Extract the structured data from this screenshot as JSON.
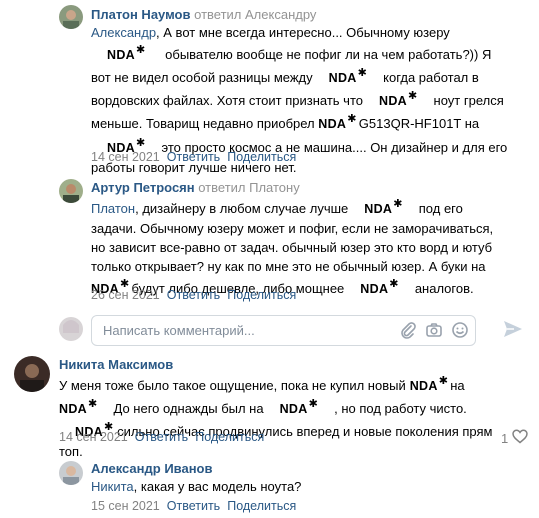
{
  "comments": [
    {
      "author": "Платон Наумов",
      "replied_word": "ответил",
      "reply_to": "Александру",
      "addr": "Александр",
      "text_parts": [
        ", А вот мне всегда интересно... Обычному юзеру",
        "обывателю вообще не пофиг ли на чем работать?)) Я вот не видел особой разницы между",
        "когда работал в вордовских файлах. Хотя стоит признать что",
        "ноут грелся меньше. Товарищ недавно приобрел",
        "G513QR-HF101T на",
        "это просто космос а не машина.... Он дизайнер и для его работы говорит лучше ничего нет."
      ],
      "date": "14 сен 2021",
      "reply": "Ответить",
      "share": "Поделиться"
    },
    {
      "author": "Артур Петросян",
      "replied_word": "ответил",
      "reply_to": "Платону",
      "addr": "Платон",
      "text_parts": [
        ", дизайнеру в любом случае лучше",
        "под его задачи. Обычному юзеру может и пофиг, если не заморачиваться, но зависит все-равно от задач. обычный юзер это кто ворд и ютуб только открывает? ну как по мне это не обычный юзер. А буки на",
        "будут либо дешевле, либо мощнее",
        "аналогов."
      ],
      "date": "26 сен 2021",
      "reply": "Ответить",
      "share": "Поделиться"
    },
    {
      "author": "Никита Максимов",
      "text_parts": [
        "У меня тоже было такое ощущение, пока не купил новый",
        "на",
        "До него однажды был на",
        ", но под работу чисто.",
        "сильно сейчас продвинулись вперед и новые поколения прям топ."
      ],
      "date": "14 сен 2021",
      "reply": "Ответить",
      "share": "Поделиться",
      "likes": "1"
    },
    {
      "author": "Александр Иванов",
      "addr": "Никита",
      "text_parts": [
        ", какая у вас модель ноута?"
      ],
      "date": "15 сен 2021",
      "reply": "Ответить",
      "share": "Поделиться"
    }
  ],
  "nda_label": "NDA",
  "nda_mark": "✱",
  "composer": {
    "placeholder": "Написать комментарий..."
  },
  "icons": [
    "attach-icon",
    "camera-icon",
    "emoji-icon",
    "send-icon",
    "heart-icon"
  ]
}
